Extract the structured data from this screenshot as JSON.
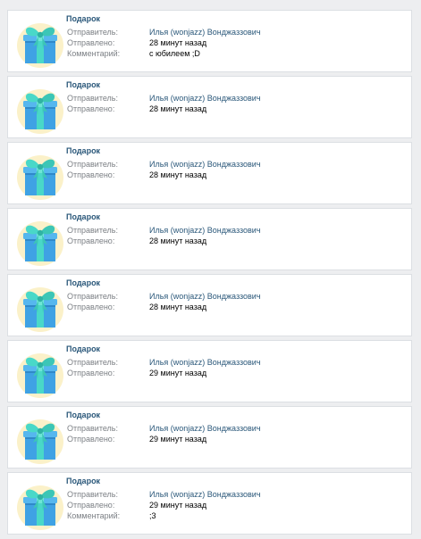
{
  "colors": {
    "background": "#edeef0",
    "card": "#ffffff",
    "card_border": "#dcdfe3",
    "title": "#2b587a",
    "label": "#7b7f84",
    "link": "#2b587a",
    "gift_box": "#3fa2e4",
    "gift_ribbon": "#49d8c8"
  },
  "gifts": [
    {
      "icon": "gift-box-icon",
      "title": "Подарок",
      "sender_label": "Отправитель:",
      "sender": "Илья (wonjazz) Вонджаззович",
      "sent_label": "Отправлено:",
      "sent": "28 минут назад",
      "comment_label": "Комментарий:",
      "comment": "с юбилеем ;D"
    },
    {
      "icon": "gift-box-icon",
      "title": "Подарок",
      "sender_label": "Отправитель:",
      "sender": "Илья (wonjazz) Вонджаззович",
      "sent_label": "Отправлено:",
      "sent": "28 минут назад"
    },
    {
      "icon": "gift-box-icon",
      "title": "Подарок",
      "sender_label": "Отправитель:",
      "sender": "Илья (wonjazz) Вонджаззович",
      "sent_label": "Отправлено:",
      "sent": "28 минут назад"
    },
    {
      "icon": "gift-box-icon",
      "title": "Подарок",
      "sender_label": "Отправитель:",
      "sender": "Илья (wonjazz) Вонджаззович",
      "sent_label": "Отправлено:",
      "sent": "28 минут назад"
    },
    {
      "icon": "gift-box-icon",
      "title": "Подарок",
      "sender_label": "Отправитель:",
      "sender": "Илья (wonjazz) Вонджаззович",
      "sent_label": "Отправлено:",
      "sent": "28 минут назад"
    },
    {
      "icon": "gift-box-icon",
      "title": "Подарок",
      "sender_label": "Отправитель:",
      "sender": "Илья (wonjazz) Вонджаззович",
      "sent_label": "Отправлено:",
      "sent": "29 минут назад"
    },
    {
      "icon": "gift-box-icon",
      "title": "Подарок",
      "sender_label": "Отправитель:",
      "sender": "Илья (wonjazz) Вонджаззович",
      "sent_label": "Отправлено:",
      "sent": "29 минут назад"
    },
    {
      "icon": "gift-box-icon",
      "title": "Подарок",
      "sender_label": "Отправитель:",
      "sender": "Илья (wonjazz) Вонджаззович",
      "sent_label": "Отправлено:",
      "sent": "29 минут назад",
      "comment_label": "Комментарий:",
      "comment": ";3"
    }
  ]
}
